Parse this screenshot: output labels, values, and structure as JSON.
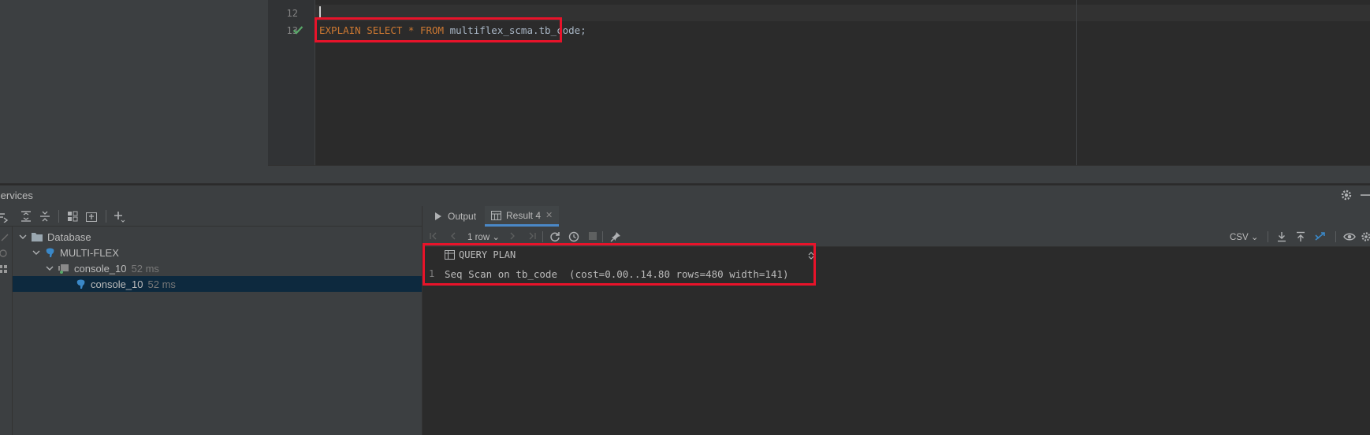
{
  "editor": {
    "line_numbers": [
      "12",
      "13"
    ],
    "code": {
      "kw1": "EXPLAIN",
      "kw2": "SELECT",
      "star": "*",
      "kw3": "FROM",
      "table": "multiflex_scma.tb_code;"
    }
  },
  "services": {
    "title": "Services",
    "tree": [
      {
        "label": "Database",
        "icon": "folder-icon"
      },
      {
        "label": "MULTI-FLEX",
        "icon": "postgres-icon"
      },
      {
        "label": "console_10",
        "time": "52 ms",
        "icon": "console-icon"
      },
      {
        "label": "console_10",
        "time": "52 ms",
        "icon": "postgres-icon"
      }
    ]
  },
  "results": {
    "tabs": [
      {
        "label": "Output",
        "icon": "output-icon"
      },
      {
        "label": "Result 4",
        "icon": "table-icon",
        "closable": true
      }
    ],
    "rows_label": "1 row",
    "export_format": "CSV",
    "column": "QUERY PLAN",
    "rows": [
      {
        "num": "1",
        "value": "Seq Scan on tb_code  (cost=0.00..14.80 rows=480 width=141)"
      }
    ]
  },
  "colors": {
    "highlight": "#e8132a",
    "keyword": "#cc7832",
    "selection": "#0d293e",
    "accent": "#4a88c7",
    "success": "#59a869"
  }
}
